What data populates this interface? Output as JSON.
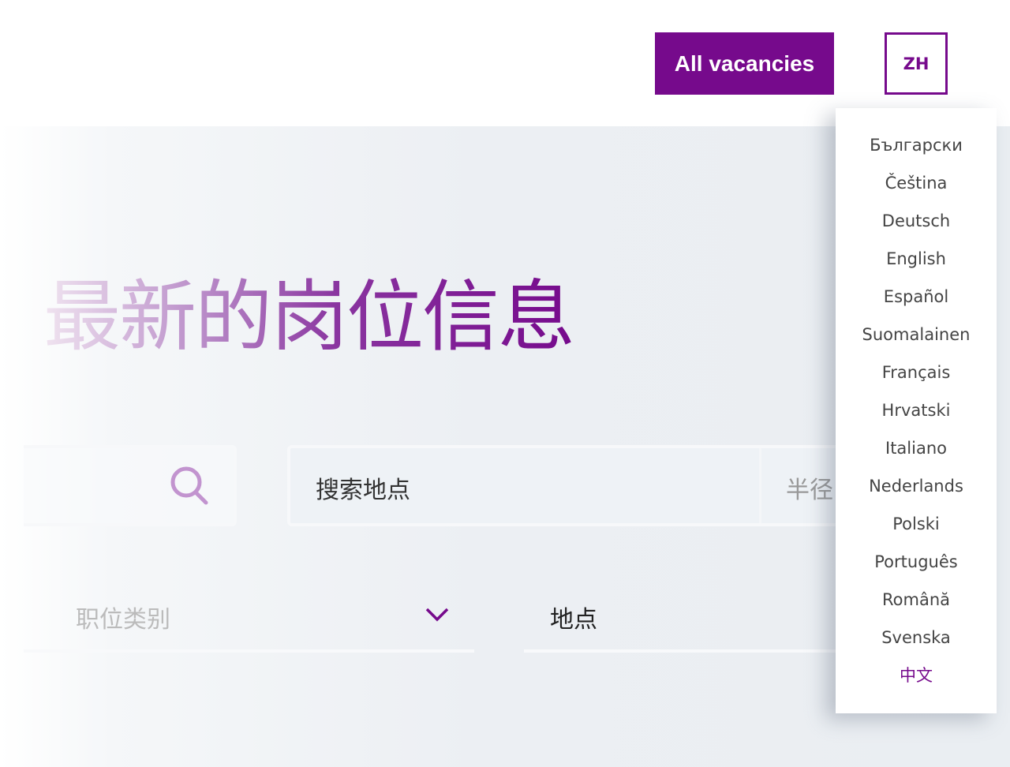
{
  "header": {
    "all_vacancies": "All vacancies",
    "language_button": "ZH"
  },
  "hero": {
    "title": "最新的岗位信息"
  },
  "search": {
    "location_placeholder": "搜索地点",
    "radius_placeholder": "半径"
  },
  "filters": {
    "category_placeholder": "职位类别",
    "location_label": "地点"
  },
  "languages": {
    "items": [
      "Български",
      "Čeština",
      "Deutsch",
      "English",
      "Español",
      "Suomalainen",
      "Français",
      "Hrvatski",
      "Italiano",
      "Nederlands",
      "Polski",
      "Português",
      "Română",
      "Svenska",
      "中文"
    ],
    "active": "中文"
  },
  "colors": {
    "brand": "#760a8c"
  }
}
